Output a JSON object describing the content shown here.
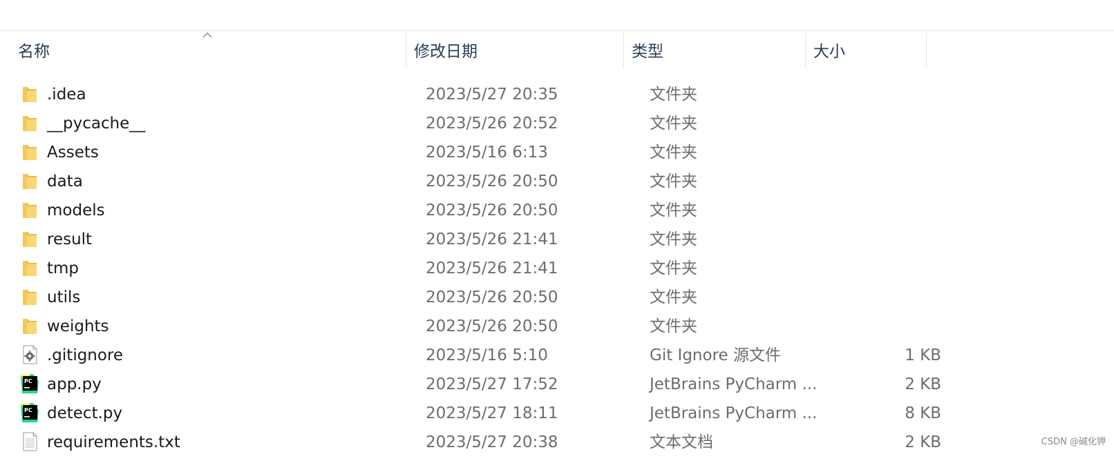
{
  "columns": {
    "name": "名称",
    "modified": "修改日期",
    "type": "类型",
    "size": "大小"
  },
  "sort": {
    "column": "name",
    "direction": "ascending",
    "icon": "sort-up-icon"
  },
  "files": [
    {
      "name": ".idea",
      "modified": "2023/5/27 20:35",
      "type": "文件夹",
      "size": "",
      "icon": "folder-icon"
    },
    {
      "name": "__pycache__",
      "modified": "2023/5/26 20:52",
      "type": "文件夹",
      "size": "",
      "icon": "folder-icon"
    },
    {
      "name": "Assets",
      "modified": "2023/5/16 6:13",
      "type": "文件夹",
      "size": "",
      "icon": "folder-icon"
    },
    {
      "name": "data",
      "modified": "2023/5/26 20:50",
      "type": "文件夹",
      "size": "",
      "icon": "folder-icon"
    },
    {
      "name": "models",
      "modified": "2023/5/26 20:50",
      "type": "文件夹",
      "size": "",
      "icon": "folder-icon"
    },
    {
      "name": "result",
      "modified": "2023/5/26 21:41",
      "type": "文件夹",
      "size": "",
      "icon": "folder-icon"
    },
    {
      "name": "tmp",
      "modified": "2023/5/26 21:41",
      "type": "文件夹",
      "size": "",
      "icon": "folder-icon"
    },
    {
      "name": "utils",
      "modified": "2023/5/26 20:50",
      "type": "文件夹",
      "size": "",
      "icon": "folder-icon"
    },
    {
      "name": "weights",
      "modified": "2023/5/26 20:50",
      "type": "文件夹",
      "size": "",
      "icon": "folder-icon"
    },
    {
      "name": ".gitignore",
      "modified": "2023/5/16 5:10",
      "type": "Git Ignore 源文件",
      "size": "1 KB",
      "icon": "gear-file-icon"
    },
    {
      "name": "app.py",
      "modified": "2023/5/27 17:52",
      "type": "JetBrains PyCharm ...",
      "size": "2 KB",
      "icon": "pycharm-icon"
    },
    {
      "name": "detect.py",
      "modified": "2023/5/27 18:11",
      "type": "JetBrains PyCharm ...",
      "size": "8 KB",
      "icon": "pycharm-icon"
    },
    {
      "name": "requirements.txt",
      "modified": "2023/5/27 20:38",
      "type": "文本文档",
      "size": "2 KB",
      "icon": "text-file-icon"
    }
  ],
  "watermark": "CSDN @碱化钾",
  "colors": {
    "header_text": "#2a3d55",
    "name_text": "#1a1a1a",
    "meta_text": "#6d6d6d",
    "folder": "#f8d775",
    "pycharm_green": "#21d789",
    "pycharm_yellow": "#fcf84a"
  }
}
